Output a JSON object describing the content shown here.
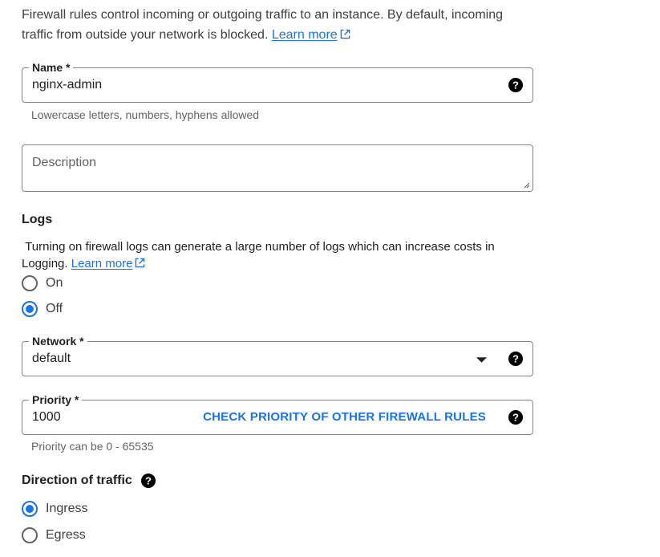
{
  "intro": {
    "text": "Firewall rules control incoming or outgoing traffic to an instance. By default, incoming traffic from outside your network is blocked.",
    "link": "Learn more"
  },
  "name_field": {
    "label": "Name *",
    "value": "nginx-admin",
    "hint": "Lowercase letters, numbers, hyphens allowed"
  },
  "description_field": {
    "placeholder": "Description"
  },
  "logs": {
    "title": "Logs",
    "text": "Turning on firewall logs can generate a large number of logs which can increase costs in Logging.",
    "link": "Learn more",
    "options": [
      {
        "label": "On",
        "checked": false
      },
      {
        "label": "Off",
        "checked": true
      }
    ]
  },
  "network_field": {
    "label": "Network *",
    "value": "default"
  },
  "priority_field": {
    "label": "Priority *",
    "value": "1000",
    "action": "CHECK PRIORITY OF OTHER FIREWALL RULES",
    "hint": "Priority can be 0 - 65535"
  },
  "direction": {
    "title": "Direction of traffic",
    "options": [
      {
        "label": "Ingress",
        "checked": true
      },
      {
        "label": "Egress",
        "checked": false
      }
    ]
  },
  "icons": {
    "help": "help-circle-icon",
    "external": "open-in-new-icon",
    "dropdown": "arrow-drop-down-icon",
    "resize": "resize-handle-icon"
  },
  "colors": {
    "accent": "#1a73e8",
    "border": "#80868b",
    "hint": "#5f6368"
  }
}
